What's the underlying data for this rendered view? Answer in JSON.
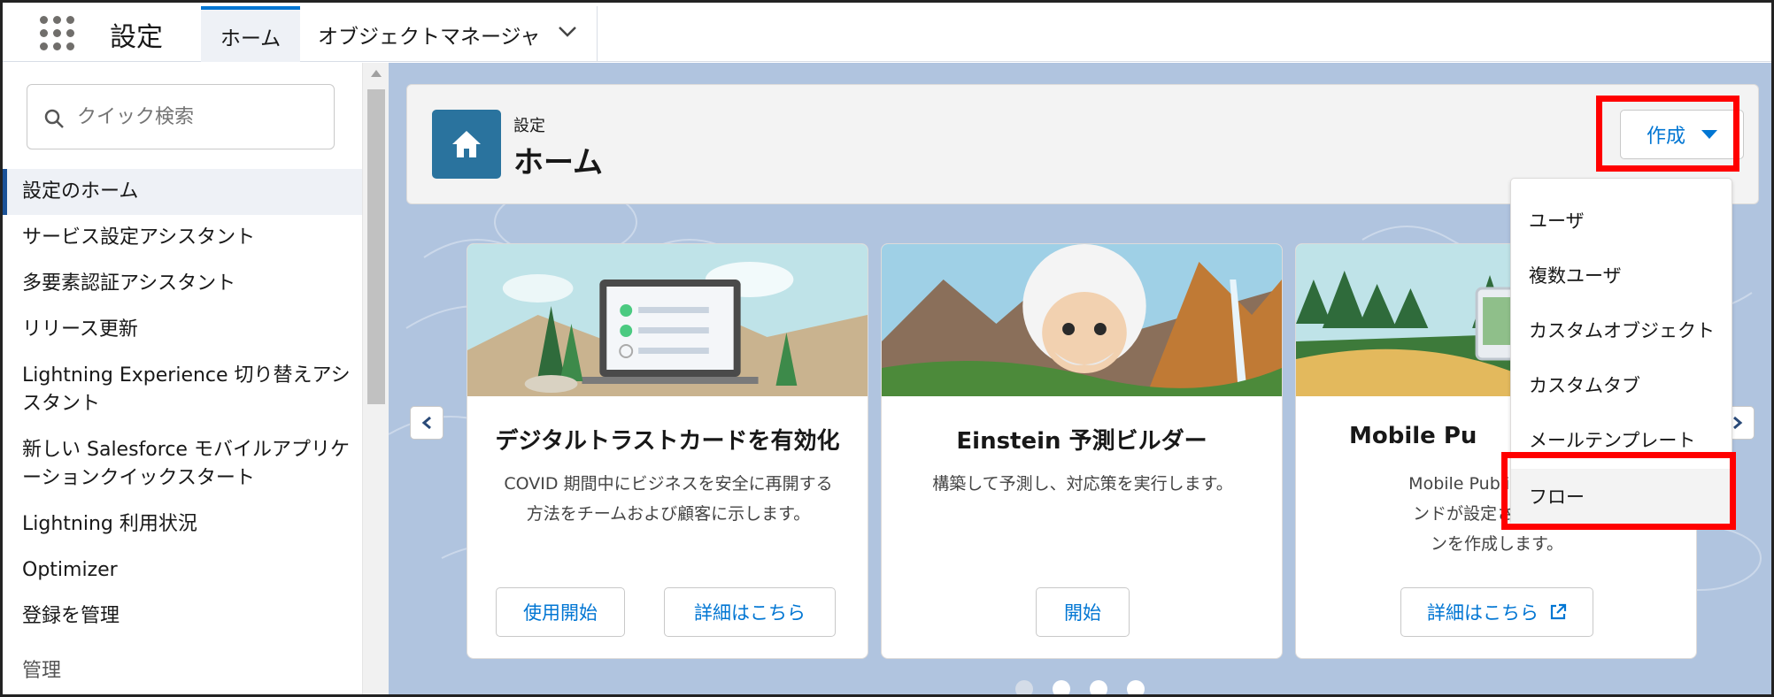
{
  "topbar": {
    "app_name": "設定",
    "tabs": [
      {
        "label": "ホーム"
      },
      {
        "label": "オブジェクトマネージャ"
      }
    ]
  },
  "sidebar": {
    "search_placeholder": "クイック検索",
    "items": [
      {
        "label": "設定のホーム",
        "active": true
      },
      {
        "label": "サービス設定アシスタント"
      },
      {
        "label": "多要素認証アシスタント"
      },
      {
        "label": "リリース更新"
      },
      {
        "label": "Lightning Experience 切り替えアシスタント"
      },
      {
        "label": "新しい Salesforce モバイルアプリケーションクイックスタート"
      },
      {
        "label": "Lightning 利用状況"
      },
      {
        "label": "Optimizer"
      },
      {
        "label": "登録を管理"
      },
      {
        "label": "管理"
      }
    ]
  },
  "header": {
    "subtitle": "設定",
    "title": "ホーム",
    "create_label": "作成"
  },
  "create_menu": {
    "items": [
      {
        "label": "ユーザ"
      },
      {
        "label": "複数ユーザ"
      },
      {
        "label": "カスタムオブジェクト"
      },
      {
        "label": "カスタムタブ"
      },
      {
        "label": "メールテンプレート"
      },
      {
        "label": "フロー"
      }
    ]
  },
  "cards": [
    {
      "title": "デジタルトラストカードを有効化",
      "description": "COVID 期間中にビジネスを安全に再開する方法をチームおよび顧客に示します。",
      "buttons": [
        "使用開始",
        "詳細はこちら"
      ]
    },
    {
      "title": "Einstein 予測ビルダー",
      "description": "構築して予測し、対応策を実行します。",
      "buttons": [
        "開始"
      ]
    },
    {
      "title": "Mobile Pu",
      "description": "Mobile Publisher を使\nンドが設定されたモバ\nンを作成します。",
      "buttons": [
        "詳細はこちら"
      ]
    }
  ],
  "carousel": {
    "pages": 4,
    "current": 1
  },
  "highlight_color": "#ff0000",
  "accent_color": "#0176d3"
}
